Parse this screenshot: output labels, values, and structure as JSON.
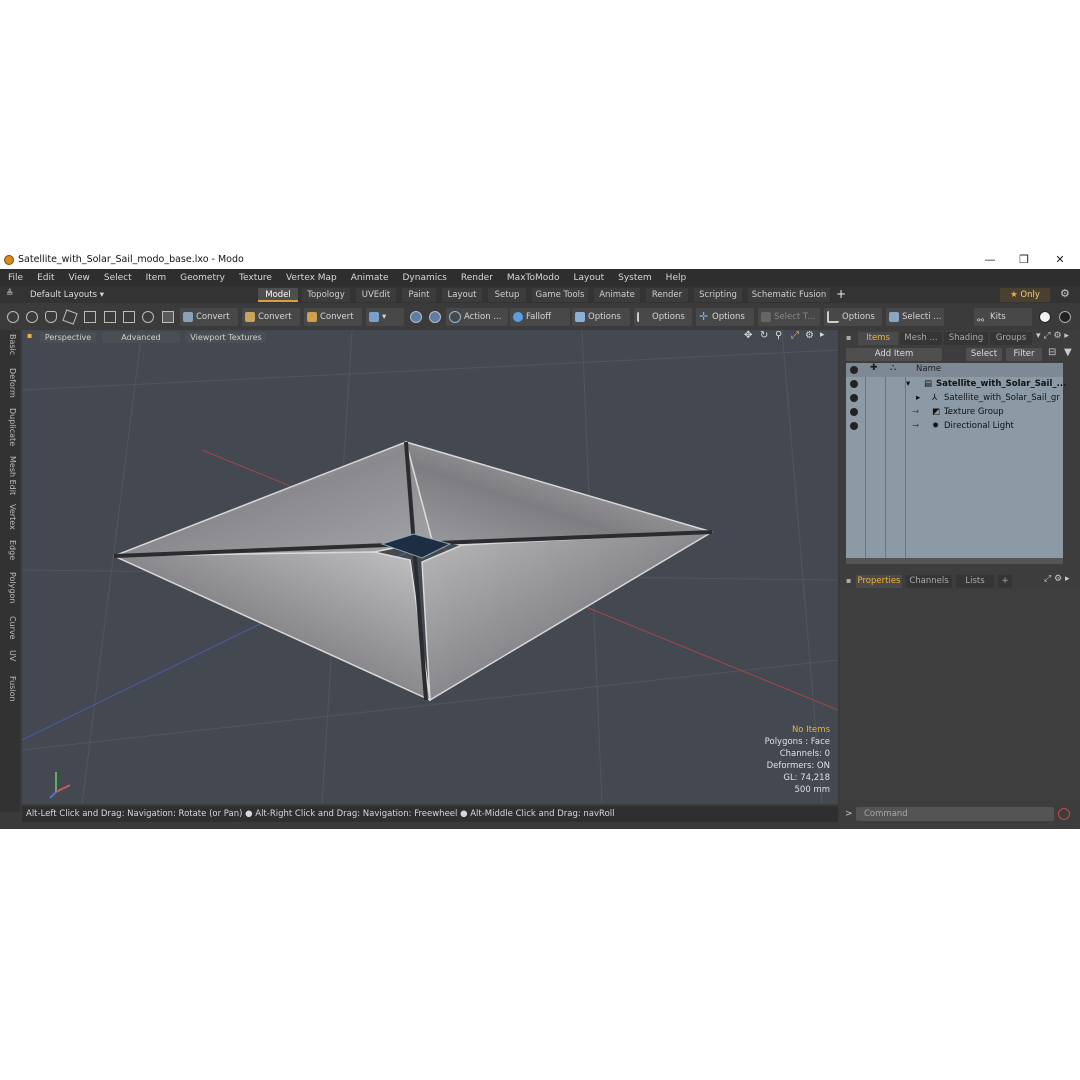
{
  "window": {
    "title": "Satellite_with_Solar_Sail_modo_base.lxo - Modo",
    "minimize": "—",
    "maximize": "❐",
    "close": "✕"
  },
  "menu": [
    "File",
    "Edit",
    "View",
    "Select",
    "Item",
    "Geometry",
    "Texture",
    "Vertex Map",
    "Animate",
    "Dynamics",
    "Render",
    "MaxToModo",
    "Layout",
    "System",
    "Help"
  ],
  "layout_selector": "Default Layouts ▾",
  "tabs": [
    "Model",
    "Topology",
    "UVEdit",
    "Paint",
    "Layout",
    "Setup",
    "Game Tools",
    "Animate",
    "Render",
    "Scripting",
    "Schematic Fusion"
  ],
  "active_tab": "Model",
  "only_label": "Only",
  "toolbar": {
    "convert1": "Convert",
    "convert2": "Convert",
    "convert3": "Convert",
    "action": "Action",
    "falloff": "Falloff",
    "options1": "Options",
    "options2": "Options",
    "options3": "Options",
    "select_t": "Select T...",
    "options4": "Options",
    "selecti": "Selecti ...",
    "kits": "Kits"
  },
  "left_tabs": [
    "Basic",
    "Deform",
    "Duplicate",
    "Mesh Edit",
    "Vertex",
    "Edge",
    "Polygon",
    "Curve",
    "UV",
    "Fusion"
  ],
  "viewport": {
    "tabs": [
      "Perspective",
      "Advanced",
      "Viewport Textures"
    ],
    "stats": {
      "no_items": "No Items",
      "polygons": "Polygons : Face",
      "channels": "Channels: 0",
      "deformers": "Deformers: ON",
      "gl": "GL: 74,218",
      "scale": "500 mm"
    }
  },
  "status_bar": "Alt-Left Click and Drag: Navigation: Rotate (or Pan) ● Alt-Right Click and Drag: Navigation: Freewheel ● Alt-Middle Click and Drag: navRoll",
  "items_panel": {
    "tabs": [
      "Items",
      "Mesh ...",
      "Shading",
      "Groups"
    ],
    "add_item": "Add Item",
    "select": "Select",
    "filter": "Filter",
    "name_header": "Name",
    "rows": [
      {
        "label": "Satellite_with_Solar_Sail_..."
      },
      {
        "label": "Satellite_with_Solar_Sail_gr ..."
      },
      {
        "label": "Texture Group"
      },
      {
        "label": "Directional Light"
      }
    ]
  },
  "properties_panel": {
    "tabs": [
      "Properties",
      "Channels",
      "Lists",
      "+"
    ]
  },
  "command": {
    "placeholder": "Command"
  },
  "colors": {
    "accent": "#f0b23a",
    "viewport_bg": "#434851",
    "panel_bg": "#3d3d3d",
    "list_bg": "#8c9aa6"
  }
}
